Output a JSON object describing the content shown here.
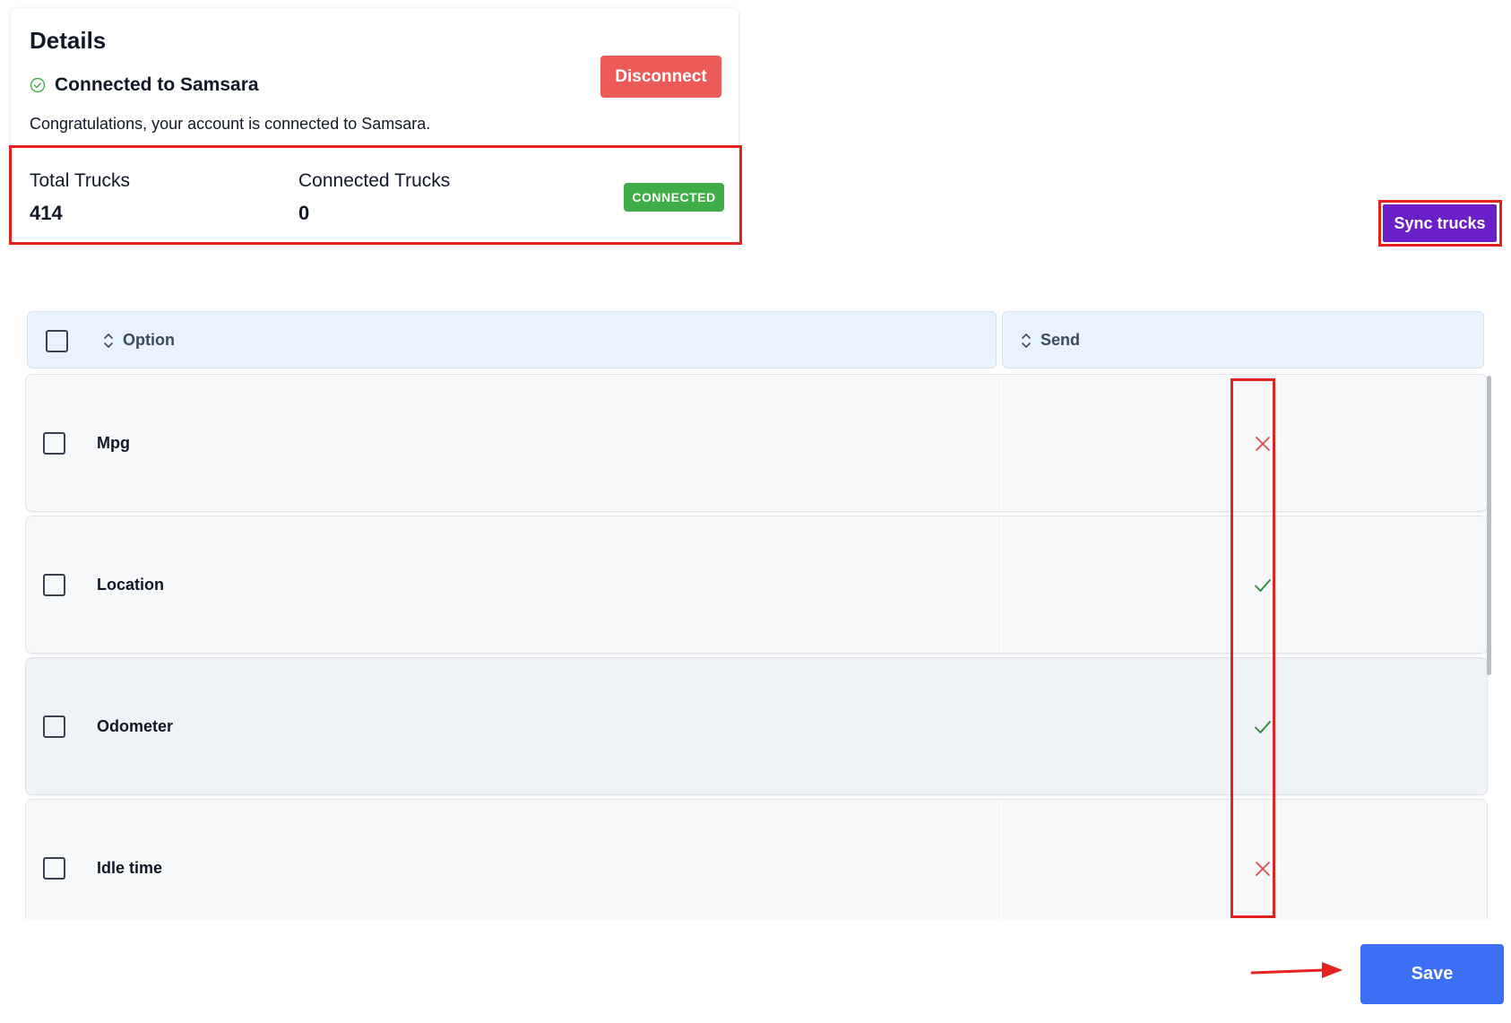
{
  "details": {
    "title": "Details",
    "connection_status": "Connected to Samsara",
    "message": "Congratulations, your account is connected to Samsara.",
    "disconnect_label": "Disconnect",
    "status_icon": "check-circle-icon",
    "colors": {
      "success": "#3fae49",
      "danger": "#ec5a5a"
    }
  },
  "stats": {
    "total_trucks_label": "Total Trucks",
    "total_trucks_value": "414",
    "connected_trucks_label": "Connected Trucks",
    "connected_trucks_value": "0",
    "badge": "CONNECTED"
  },
  "actions": {
    "sync_label": "Sync trucks",
    "save_label": "Save",
    "colors": {
      "sync": "#6a1fc9",
      "save": "#3d6ff4"
    }
  },
  "table": {
    "columns": [
      {
        "label": "Option",
        "icon": "sort-icon"
      },
      {
        "label": "Send",
        "icon": "sort-icon"
      }
    ],
    "rows": [
      {
        "option": "Mpg",
        "send": false,
        "send_icon": "x-icon"
      },
      {
        "option": "Location",
        "send": true,
        "send_icon": "check-icon"
      },
      {
        "option": "Odometer",
        "send": true,
        "send_icon": "check-icon"
      },
      {
        "option": "Idle time",
        "send": false,
        "send_icon": "x-icon"
      }
    ]
  }
}
